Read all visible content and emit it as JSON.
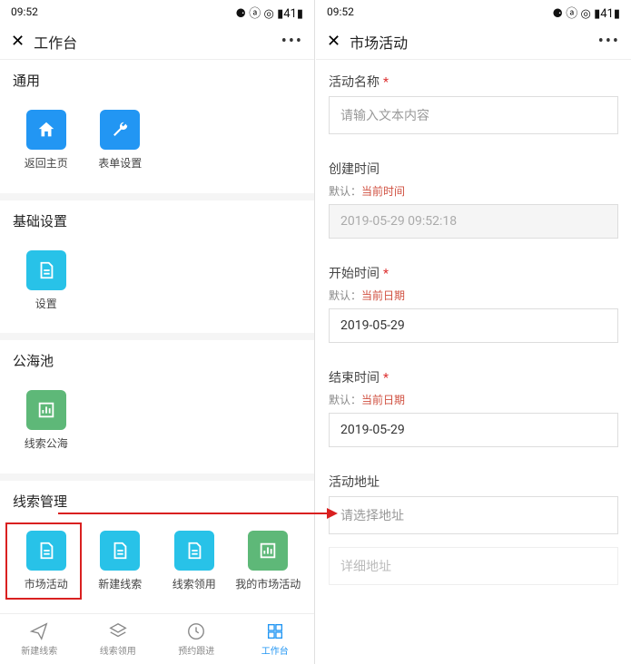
{
  "statusbar": {
    "time": "09:52",
    "signal": "📶📶 📡",
    "battery": "▮41▮",
    "icons": "⚙ⓐ◎"
  },
  "left": {
    "title": "工作台",
    "groups": [
      {
        "title": "通用",
        "items": [
          {
            "label": "返回主页",
            "color": "blue",
            "icon": "home"
          },
          {
            "label": "表单设置",
            "color": "blue",
            "icon": "wrench"
          }
        ]
      },
      {
        "title": "基础设置",
        "items": [
          {
            "label": "设置",
            "color": "cyan",
            "icon": "doc"
          }
        ]
      },
      {
        "title": "公海池",
        "items": [
          {
            "label": "线索公海",
            "color": "green",
            "icon": "chart"
          }
        ]
      },
      {
        "title": "线索管理",
        "items": [
          {
            "label": "市场活动",
            "color": "cyan",
            "icon": "doc"
          },
          {
            "label": "新建线索",
            "color": "cyan",
            "icon": "doc"
          },
          {
            "label": "线索领用",
            "color": "cyan",
            "icon": "doc"
          },
          {
            "label": "我的市场活动",
            "color": "green",
            "icon": "chart"
          }
        ]
      }
    ],
    "highlight": "市场活动",
    "tabs": [
      {
        "label": "新建线索",
        "icon": "send",
        "active": false
      },
      {
        "label": "线索领用",
        "icon": "layers",
        "active": false
      },
      {
        "label": "预约跟进",
        "icon": "clock",
        "active": false
      },
      {
        "label": "工作台",
        "icon": "grid",
        "active": true
      }
    ]
  },
  "right": {
    "title": "市场活动",
    "fields": [
      {
        "label": "活动名称",
        "required": true,
        "hint": null,
        "placeholder": "请输入文本内容",
        "value": null,
        "readonly": false
      },
      {
        "label": "创建时间",
        "required": false,
        "hint": "默认：当前时间",
        "placeholder": null,
        "value": "2019-05-29 09:52:18",
        "readonly": true
      },
      {
        "label": "开始时间",
        "required": true,
        "hint": "默认：当前日期",
        "placeholder": null,
        "value": "2019-05-29",
        "readonly": false
      },
      {
        "label": "结束时间",
        "required": true,
        "hint": "默认：当前日期",
        "placeholder": null,
        "value": "2019-05-29",
        "readonly": false
      },
      {
        "label": "活动地址",
        "required": false,
        "hint": null,
        "placeholder": "请选择地址",
        "value": null,
        "readonly": false,
        "extra_placeholder": "详细地址"
      }
    ]
  }
}
